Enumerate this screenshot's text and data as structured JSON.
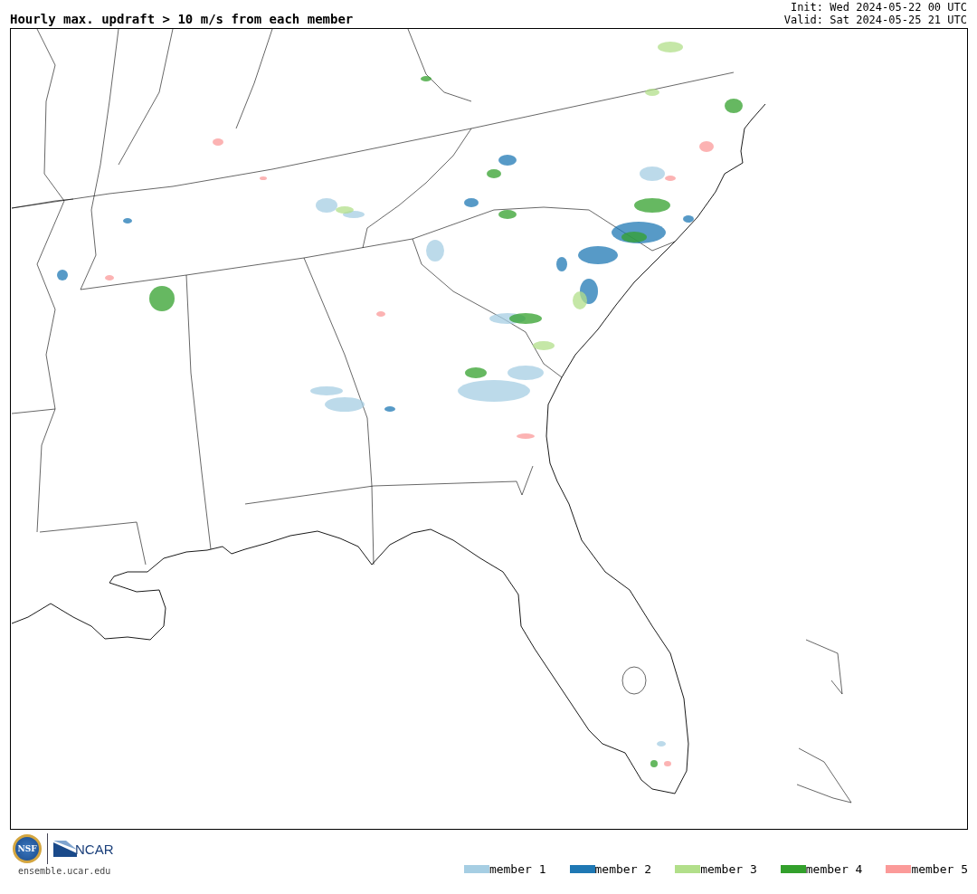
{
  "title": "Hourly max. updraft > 10 m/s from each member",
  "init": "Init: Wed 2024-05-22 00 UTC",
  "valid": "Valid: Sat 2024-05-25 21 UTC",
  "logo": {
    "left": "NSF",
    "right": "NCAR",
    "url": "ensemble.ucar.edu"
  },
  "legend": [
    {
      "label": "member 1",
      "color": "#a6cee3"
    },
    {
      "label": "member 2",
      "color": "#1f78b4"
    },
    {
      "label": "member 3",
      "color": "#b2df8a"
    },
    {
      "label": "member 4",
      "color": "#33a02c"
    },
    {
      "label": "member 5",
      "color": "#fb9a99"
    }
  ]
}
